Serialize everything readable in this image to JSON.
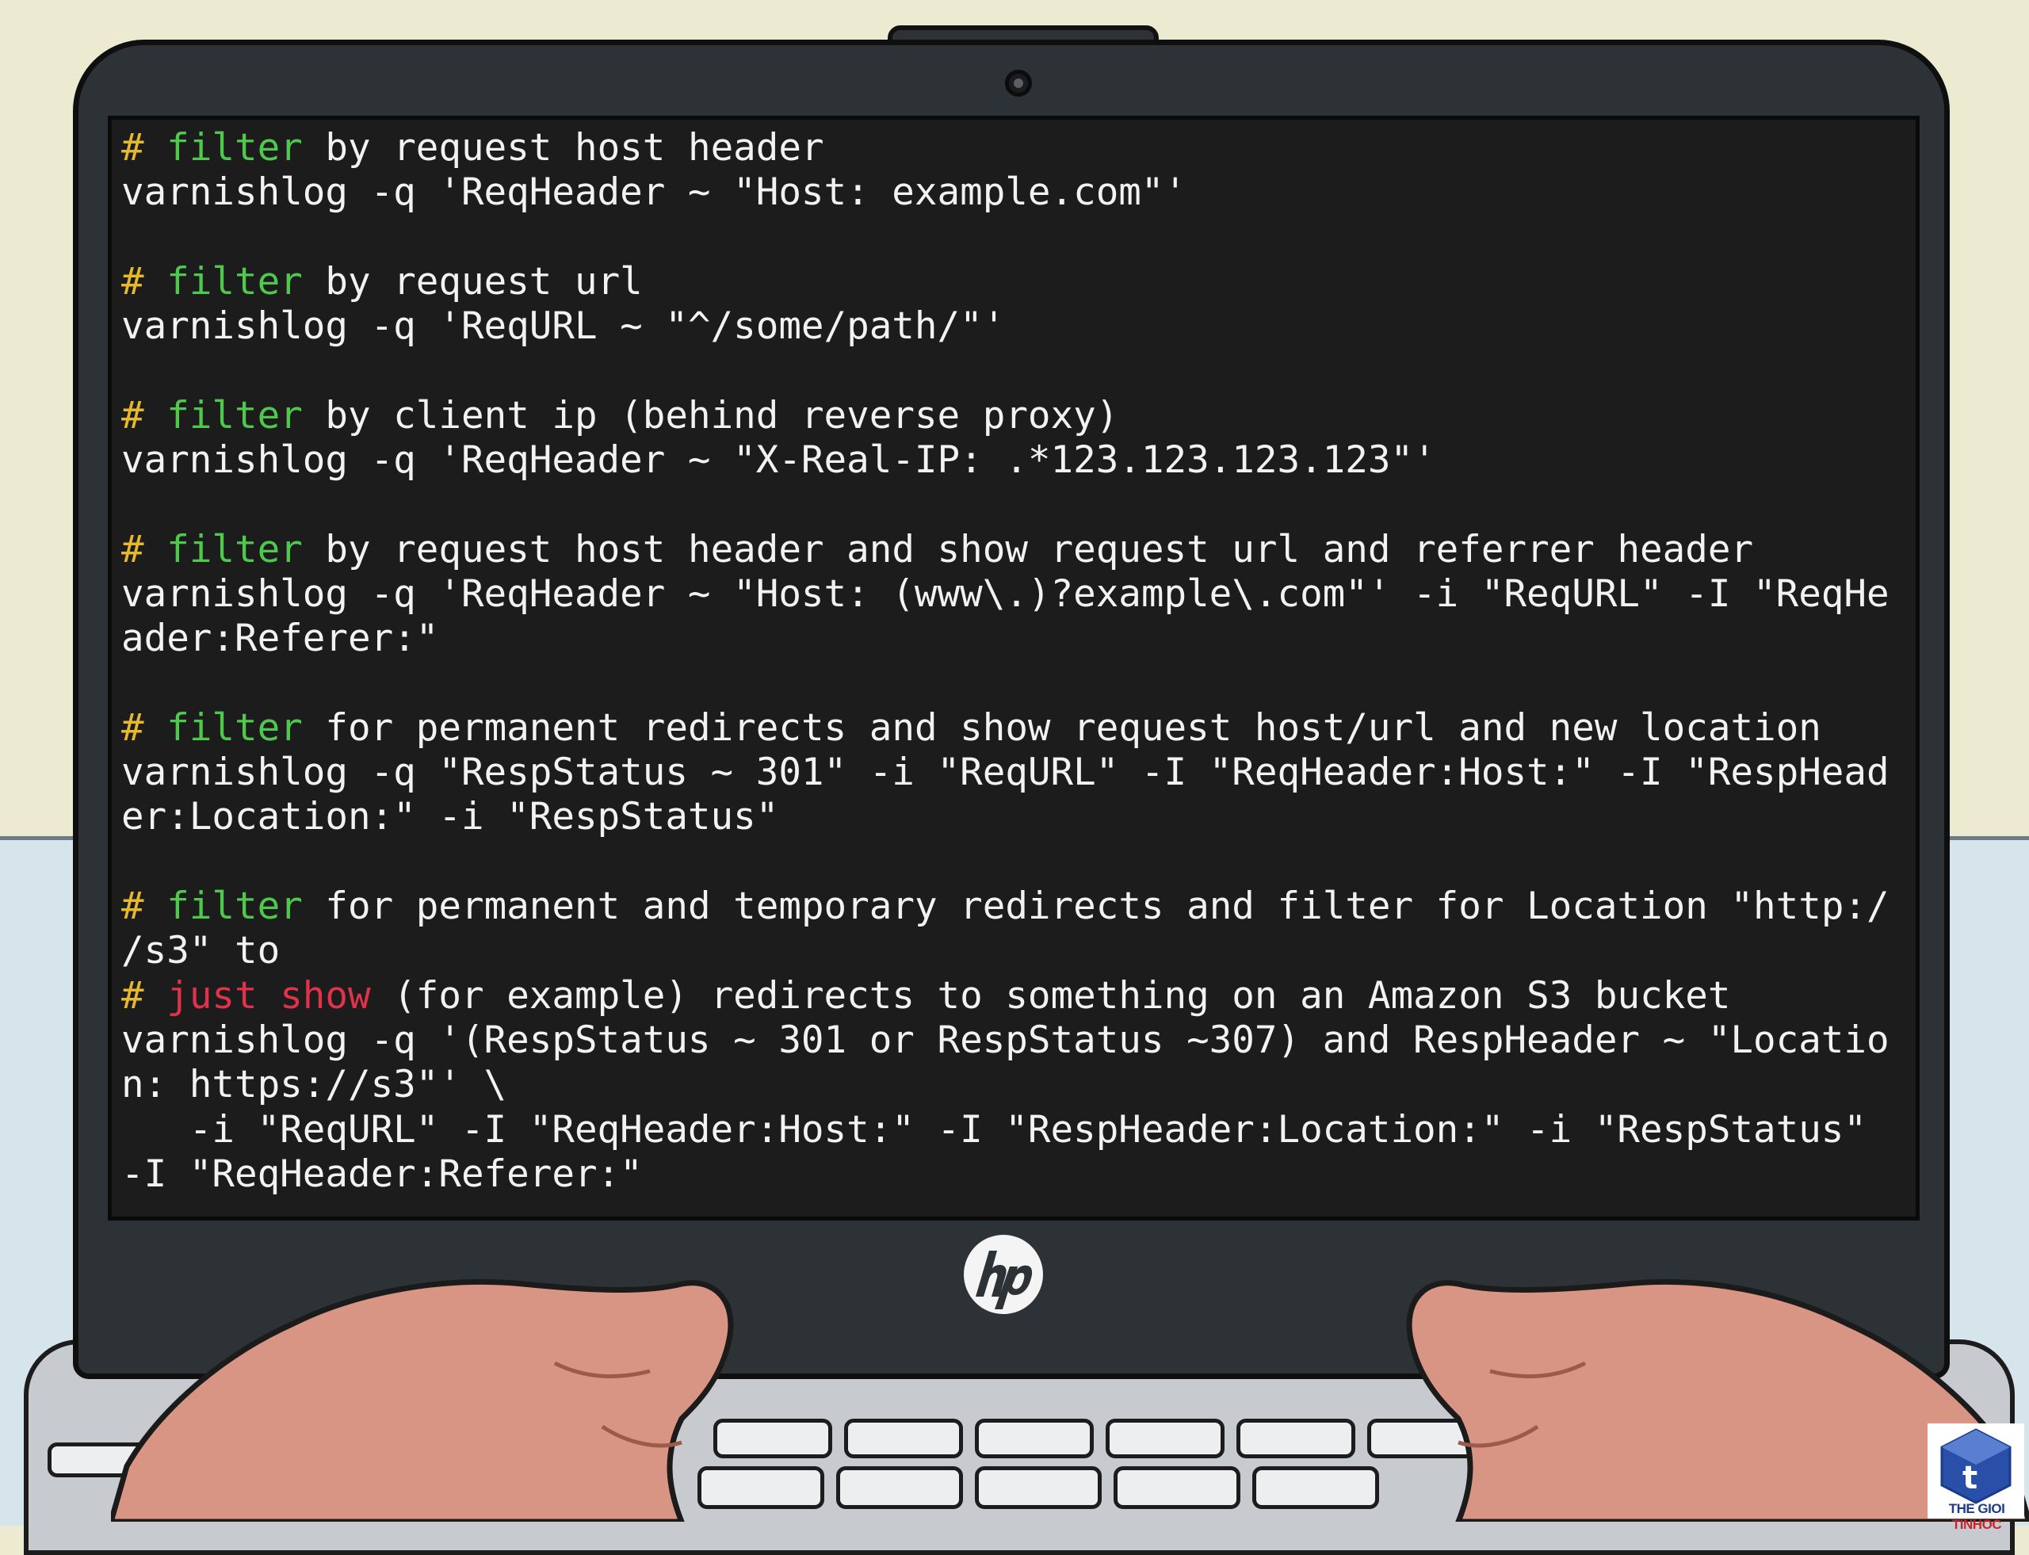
{
  "terminal": {
    "lines": [
      [
        {
          "t": "#",
          "c": "hash"
        },
        {
          "t": " "
        },
        {
          "t": "filter",
          "c": "kw-green"
        },
        {
          "t": " by request host header"
        }
      ],
      [
        {
          "t": "varnishlog -q 'ReqHeader ~ \"Host: example.com\"'"
        }
      ],
      [
        {
          "t": ""
        }
      ],
      [
        {
          "t": "#",
          "c": "hash"
        },
        {
          "t": " "
        },
        {
          "t": "filter",
          "c": "kw-green"
        },
        {
          "t": " by request url"
        }
      ],
      [
        {
          "t": "varnishlog -q 'ReqURL ~ \"^/some/path/\"'"
        }
      ],
      [
        {
          "t": ""
        }
      ],
      [
        {
          "t": "#",
          "c": "hash"
        },
        {
          "t": " "
        },
        {
          "t": "filter",
          "c": "kw-green"
        },
        {
          "t": " by client ip (behind reverse proxy)"
        }
      ],
      [
        {
          "t": "varnishlog -q 'ReqHeader ~ \"X-Real-IP: .*123.123.123.123\"'"
        }
      ],
      [
        {
          "t": ""
        }
      ],
      [
        {
          "t": "#",
          "c": "hash"
        },
        {
          "t": " "
        },
        {
          "t": "filter",
          "c": "kw-green"
        },
        {
          "t": " by request host header and show request url and referrer header"
        }
      ],
      [
        {
          "t": "varnishlog -q 'ReqHeader ~ \"Host: (www\\.)?example\\.com\"' -i \"ReqURL\" -I \"ReqHe"
        }
      ],
      [
        {
          "t": "ader:Referer:\""
        }
      ],
      [
        {
          "t": ""
        }
      ],
      [
        {
          "t": "#",
          "c": "hash"
        },
        {
          "t": " "
        },
        {
          "t": "filter",
          "c": "kw-green"
        },
        {
          "t": " for permanent redirects and show request host/url and new location"
        }
      ],
      [
        {
          "t": "varnishlog -q \"RespStatus ~ 301\" -i \"ReqURL\" -I \"ReqHeader:Host:\" -I \"RespHead"
        }
      ],
      [
        {
          "t": "er:Location:\" -i \"RespStatus\""
        }
      ],
      [
        {
          "t": ""
        }
      ],
      [
        {
          "t": "#",
          "c": "hash"
        },
        {
          "t": " "
        },
        {
          "t": "filter",
          "c": "kw-green"
        },
        {
          "t": " for permanent and temporary redirects and filter for Location \"http:/"
        }
      ],
      [
        {
          "t": "/s3\" to"
        }
      ],
      [
        {
          "t": "#",
          "c": "hash"
        },
        {
          "t": " "
        },
        {
          "t": "just show",
          "c": "kw-red"
        },
        {
          "t": " (for example) redirects to something on an Amazon S3 bucket"
        }
      ],
      [
        {
          "t": "varnishlog -q '(RespStatus ~ 301 or RespStatus ~307) and RespHeader ~ \"Locatio"
        }
      ],
      [
        {
          "t": "n: https://s3\"' \\"
        }
      ],
      [
        {
          "t": "   -i \"ReqURL\" -I \"ReqHeader:Host:\" -I \"RespHeader:Location:\" -i \"RespStatus\""
        }
      ],
      [
        {
          "t": "-I \"ReqHeader:Referer:\""
        }
      ]
    ]
  },
  "colors": {
    "comment_hash": "#e6b82e",
    "keyword_green": "#4ec94e",
    "keyword_red": "#e0324a",
    "terminal_bg": "#1c1c1c",
    "terminal_text": "#f2f2f2"
  },
  "laptop": {
    "logo_icon": "hp-logo-icon"
  },
  "watermark": {
    "line1": "THE GIOI",
    "line2": "TINHOC"
  }
}
